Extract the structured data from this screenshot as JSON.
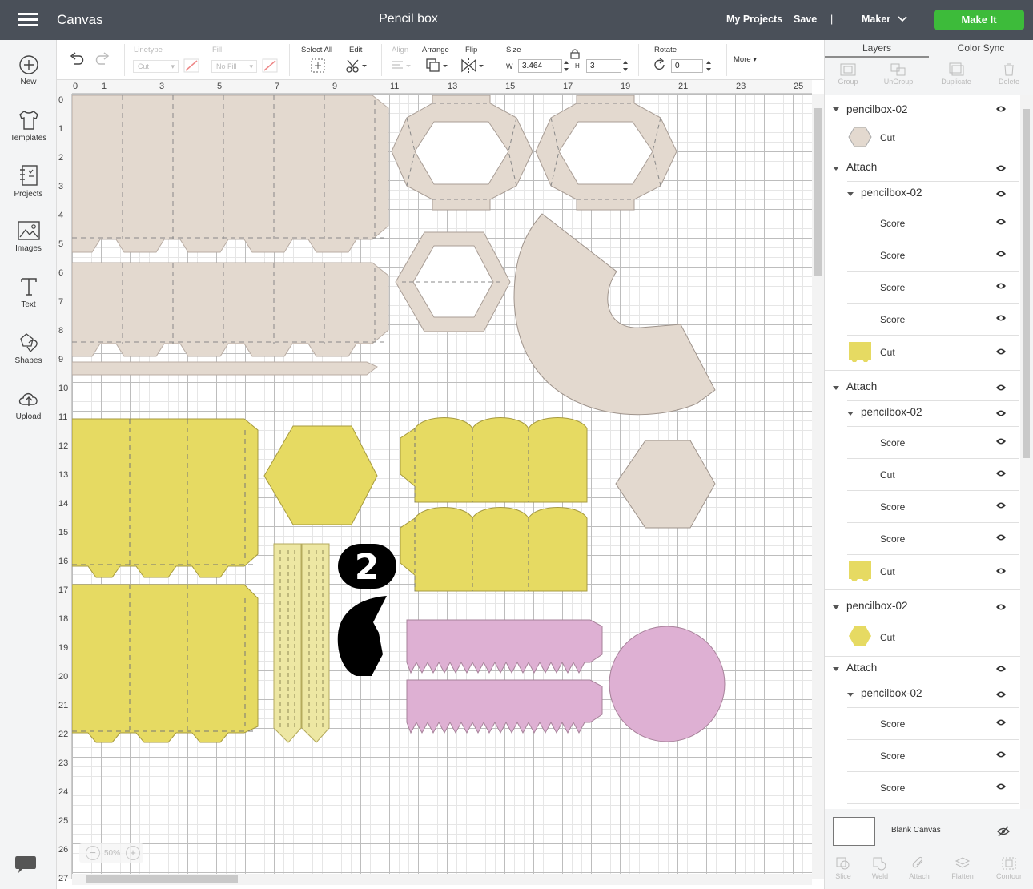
{
  "topbar": {
    "app_name": "Canvas",
    "doc_title": "Pencil box",
    "my_projects": "My Projects",
    "save": "Save",
    "separator": "|",
    "machine": "Maker",
    "make_it": "Make It"
  },
  "nav": {
    "new": "New",
    "templates": "Templates",
    "projects": "Projects",
    "images": "Images",
    "text": "Text",
    "shapes": "Shapes",
    "upload": "Upload"
  },
  "toolbar": {
    "linetype_label": "Linetype",
    "linetype_value": "Cut",
    "fill_label": "Fill",
    "fill_value": "No Fill",
    "select_all": "Select All",
    "edit": "Edit",
    "align": "Align",
    "arrange": "Arrange",
    "flip": "Flip",
    "size_label": "Size",
    "w_label": "W",
    "w_value": "3.464",
    "h_label": "H",
    "h_value": "3",
    "rotate_label": "Rotate",
    "rotate_value": "0",
    "more": "More"
  },
  "ruler": {
    "x": [
      "0",
      "1",
      "3",
      "5",
      "7",
      "9",
      "11",
      "13",
      "15",
      "17",
      "19",
      "21",
      "23",
      "25"
    ],
    "y": [
      "0",
      "1",
      "2",
      "3",
      "4",
      "5",
      "6",
      "7",
      "8",
      "9",
      "10",
      "11",
      "12",
      "13",
      "14",
      "15",
      "16",
      "17",
      "18",
      "19",
      "20",
      "21",
      "22",
      "23",
      "24",
      "25",
      "26",
      "27"
    ]
  },
  "zoom": {
    "minus": "−",
    "value": "50%",
    "plus": "+"
  },
  "canvas": {
    "number_label": "2"
  },
  "colors": {
    "beige": "#e3d9cf",
    "yellow": "#e6da62",
    "light_yellow": "#ede7a3",
    "pink": "#deb0d3",
    "black": "#000000",
    "topbar": "#4a5059",
    "make_it": "#3dbb3a"
  },
  "panel": {
    "tab_layers": "Layers",
    "tab_color_sync": "Color Sync",
    "group": "Group",
    "ungroup": "UnGroup",
    "duplicate": "Duplicate",
    "delete": "Delete",
    "layers": [
      {
        "name": "pencilbox-02"
      },
      {
        "name": "Cut"
      },
      {
        "name": "Attach"
      },
      {
        "name": "pencilbox-02"
      },
      {
        "name": "Score"
      },
      {
        "name": "Score"
      },
      {
        "name": "Score"
      },
      {
        "name": "Score"
      },
      {
        "name": "Cut"
      },
      {
        "name": "Attach"
      },
      {
        "name": "pencilbox-02"
      },
      {
        "name": "Score"
      },
      {
        "name": "Cut"
      },
      {
        "name": "Score"
      },
      {
        "name": "Score"
      },
      {
        "name": "Cut"
      },
      {
        "name": "pencilbox-02"
      },
      {
        "name": "Cut"
      },
      {
        "name": "Attach"
      },
      {
        "name": "pencilbox-02"
      },
      {
        "name": "Score"
      },
      {
        "name": "Score"
      },
      {
        "name": "Score"
      }
    ],
    "blank_canvas": "Blank Canvas",
    "slice": "Slice",
    "weld": "Weld",
    "attach": "Attach",
    "flatten": "Flatten",
    "contour": "Contour"
  }
}
